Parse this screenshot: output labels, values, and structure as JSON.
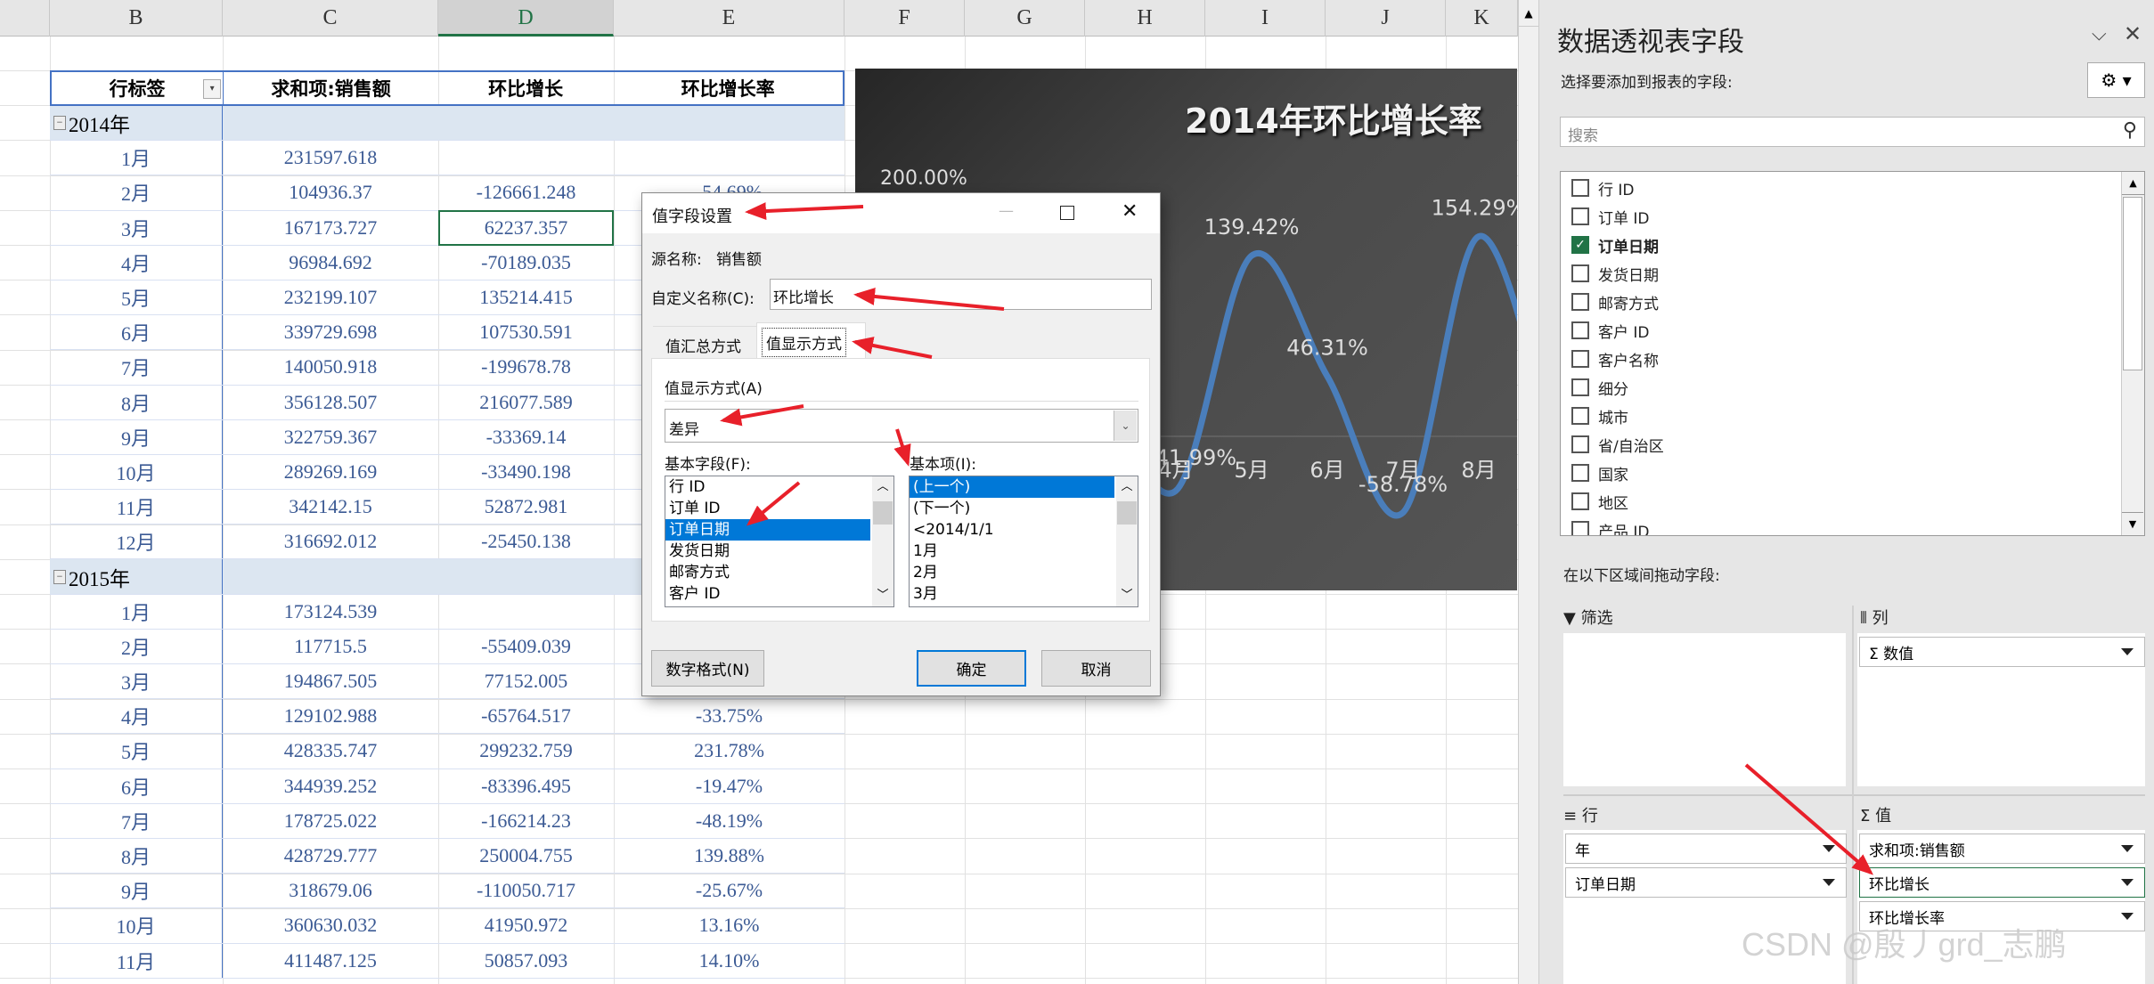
{
  "sheet": {
    "columns": [
      "B",
      "C",
      "D",
      "E",
      "F",
      "G",
      "H",
      "I",
      "J",
      "K"
    ],
    "selected_column": "D",
    "pivot": {
      "headers": [
        "行标签",
        "求和项:销售额",
        "环比增长",
        "环比增长率"
      ],
      "groups": [
        {
          "label": "2014年",
          "rows": [
            {
              "label": "1月",
              "sales": "231597.618",
              "diff": "",
              "rate": ""
            },
            {
              "label": "2月",
              "sales": "104936.37",
              "diff": "-126661.248",
              "rate": "-54.69%"
            },
            {
              "label": "3月",
              "sales": "167173.727",
              "diff": "62237.357",
              "rate": ""
            },
            {
              "label": "4月",
              "sales": "96984.692",
              "diff": "-70189.035",
              "rate": ""
            },
            {
              "label": "5月",
              "sales": "232199.107",
              "diff": "135214.415",
              "rate": ""
            },
            {
              "label": "6月",
              "sales": "339729.698",
              "diff": "107530.591",
              "rate": ""
            },
            {
              "label": "7月",
              "sales": "140050.918",
              "diff": "-199678.78",
              "rate": ""
            },
            {
              "label": "8月",
              "sales": "356128.507",
              "diff": "216077.589",
              "rate": ""
            },
            {
              "label": "9月",
              "sales": "322759.367",
              "diff": "-33369.14",
              "rate": ""
            },
            {
              "label": "10月",
              "sales": "289269.169",
              "diff": "-33490.198",
              "rate": ""
            },
            {
              "label": "11月",
              "sales": "342142.15",
              "diff": "52872.981",
              "rate": ""
            },
            {
              "label": "12月",
              "sales": "316692.012",
              "diff": "-25450.138",
              "rate": ""
            }
          ]
        },
        {
          "label": "2015年",
          "rows": [
            {
              "label": "1月",
              "sales": "173124.539",
              "diff": "",
              "rate": ""
            },
            {
              "label": "2月",
              "sales": "117715.5",
              "diff": "-55409.039",
              "rate": ""
            },
            {
              "label": "3月",
              "sales": "194867.505",
              "diff": "77152.005",
              "rate": ""
            },
            {
              "label": "4月",
              "sales": "129102.988",
              "diff": "-65764.517",
              "rate": "-33.75%"
            },
            {
              "label": "5月",
              "sales": "428335.747",
              "diff": "299232.759",
              "rate": "231.78%"
            },
            {
              "label": "6月",
              "sales": "344939.252",
              "diff": "-83396.495",
              "rate": "-19.47%"
            },
            {
              "label": "7月",
              "sales": "178725.022",
              "diff": "-166214.23",
              "rate": "-48.19%"
            },
            {
              "label": "8月",
              "sales": "428729.777",
              "diff": "250004.755",
              "rate": "139.88%"
            },
            {
              "label": "9月",
              "sales": "318679.06",
              "diff": "-110050.717",
              "rate": "-25.67%"
            },
            {
              "label": "10月",
              "sales": "360630.032",
              "diff": "41950.972",
              "rate": "13.16%"
            },
            {
              "label": "11月",
              "sales": "411487.125",
              "diff": "50857.093",
              "rate": "14.10%"
            }
          ]
        }
      ]
    }
  },
  "chart_data": {
    "type": "line",
    "title": "2014年环比增长率",
    "categories": [
      "4月",
      "5月",
      "6月",
      "7月",
      "8月"
    ],
    "series": [
      {
        "values": [
          -41.99,
          139.42,
          46.31,
          -58.78,
          154.29
        ],
        "labels": [
          "-41.99%",
          "139.42%",
          "46.31%",
          "-58.78%",
          "154.29%"
        ],
        "color": "#4a7ebb"
      }
    ],
    "y_tick_labels": [
      "200.00%"
    ],
    "ylim": [
      -80,
      200
    ],
    "smooth": true,
    "background": "dark gradient"
  },
  "dialog": {
    "title": "值字段设置",
    "source_label": "源名称:",
    "source_value": "销售额",
    "custom_name_label": "自定义名称(C):",
    "custom_name_value": "环比增长",
    "tabs": [
      "值汇总方式",
      "值显示方式"
    ],
    "active_tab": 1,
    "show_as_label": "值显示方式(A)",
    "show_as_value": "差异",
    "base_field_label": "基本字段(F):",
    "base_fields": [
      "行 ID",
      "订单 ID",
      "订单日期",
      "发货日期",
      "邮寄方式",
      "客户 ID"
    ],
    "base_field_selected": 2,
    "base_item_label": "基本项(I):",
    "base_items": [
      "(上一个)",
      "(下一个)",
      "<2014/1/1",
      "1月",
      "2月",
      "3月"
    ],
    "base_item_selected": 0,
    "number_format_button": "数字格式(N)",
    "ok_button": "确定",
    "cancel_button": "取消"
  },
  "panel": {
    "title": "数据透视表字段",
    "choose_label": "选择要添加到报表的字段:",
    "search_placeholder": "搜索",
    "fields": [
      {
        "label": "行 ID",
        "checked": false
      },
      {
        "label": "订单 ID",
        "checked": false
      },
      {
        "label": "订单日期",
        "checked": true
      },
      {
        "label": "发货日期",
        "checked": false
      },
      {
        "label": "邮寄方式",
        "checked": false
      },
      {
        "label": "客户 ID",
        "checked": false
      },
      {
        "label": "客户名称",
        "checked": false
      },
      {
        "label": "细分",
        "checked": false
      },
      {
        "label": "城市",
        "checked": false
      },
      {
        "label": "省/自治区",
        "checked": false
      },
      {
        "label": "国家",
        "checked": false
      },
      {
        "label": "地区",
        "checked": false
      },
      {
        "label": "产品 ID",
        "checked": false
      }
    ],
    "drag_label": "在以下区域间拖动字段:",
    "filters_label": "筛选",
    "columns_label": "列",
    "columns_items": [
      "Σ 数值"
    ],
    "rows_label": "行",
    "rows_items": [
      "年",
      "订单日期"
    ],
    "values_label": "值",
    "values_items": [
      "求和项:销售额",
      "环比增长",
      "环比增长率"
    ],
    "accent": "#217346"
  },
  "watermark": "CSDN @殷丿grd_志鹏"
}
